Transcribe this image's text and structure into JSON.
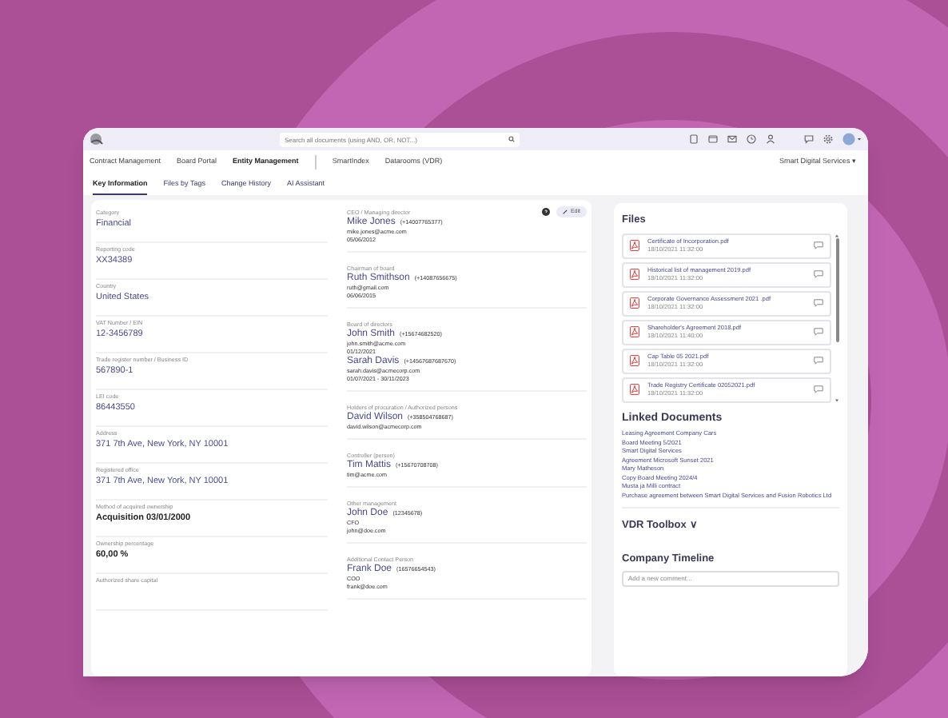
{
  "top_bar": {
    "search": {
      "placeholder": "Search all documents (using AND, OR, NOT...)"
    }
  },
  "nav": {
    "items": [
      {
        "label": "Contract Management",
        "selected": false
      },
      {
        "label": "Board Portal",
        "selected": false
      },
      {
        "label": "Entity Management",
        "selected": true
      },
      {
        "label": "SmartIndex",
        "selected": false
      },
      {
        "label": "Datarooms (VDR)",
        "selected": false
      }
    ],
    "company": "Smart Digital Services",
    "company_caret": "▾"
  },
  "tabs": [
    {
      "label": "Key Information",
      "selected": true
    },
    {
      "label": "Files by Tags",
      "selected": false
    },
    {
      "label": "Change History",
      "selected": false
    },
    {
      "label": "AI Assistant",
      "selected": false
    }
  ],
  "key_info": {
    "edit_button": "Edit",
    "fields": [
      {
        "label": "Category",
        "value": "Financial",
        "kind": "link"
      },
      {
        "label": "Reporting code",
        "value": "XX34389",
        "kind": "link"
      },
      {
        "label": "Country",
        "value": "United States",
        "kind": "link"
      },
      {
        "label": "VAT Number / EIN",
        "value": "12-3456789",
        "kind": "link"
      },
      {
        "label": "Trade register number / Business ID",
        "value": "567890-1",
        "kind": "link"
      },
      {
        "label": "LEI code",
        "value": "86443550",
        "kind": "link"
      },
      {
        "label": "Address",
        "value": "371 7th Ave, New York, NY 10001",
        "kind": "link"
      },
      {
        "label": "Registered office",
        "value": "371 7th Ave, New York, NY 10001",
        "kind": "link"
      },
      {
        "label": "Method of acquired ownership",
        "value": "Acquisition 03/01/2000",
        "kind": "plain"
      },
      {
        "label": "Ownership percentage",
        "value": "60,00 %",
        "kind": "plain"
      },
      {
        "label": "Authorized share capital"
      }
    ]
  },
  "contacts": [
    {
      "label": "CEO / Managing director",
      "persons": [
        {
          "name": "Mike Jones",
          "phone": "(+14007765377)",
          "lines": [
            "mike.jones@acme.com",
            "05/06/2012"
          ]
        }
      ]
    },
    {
      "label": "Chairman of board",
      "persons": [
        {
          "name": "Ruth Smithson",
          "phone": "(+14087656675)",
          "lines": [
            "ruth@gmail.com",
            "06/06/2015"
          ]
        }
      ]
    },
    {
      "label": "Board of directors",
      "persons": [
        {
          "name": "John Smith",
          "phone": "(+15674682520)",
          "lines": [
            "john.smith@acme.com",
            "01/12/2021"
          ]
        },
        {
          "name": "Sarah Davis",
          "phone": "(+14567687687670)",
          "lines": [
            "sarah.davis@acmecorp.com",
            "01/07/2021 - 30/11/2023"
          ]
        }
      ]
    },
    {
      "label": "Holders of procuration / Authorized persons",
      "persons": [
        {
          "name": "David Wilson",
          "phone": "(+358504768687)",
          "lines": [
            "david.wilson@acmecorp.com"
          ]
        }
      ]
    },
    {
      "label": "Controller (person)",
      "persons": [
        {
          "name": "Tim Mattis",
          "phone": "(+15670708708)",
          "lines": [
            "tim@acme.com"
          ]
        }
      ]
    },
    {
      "label": "Other management",
      "persons": [
        {
          "name": "John Doe",
          "phone": "(12345678)",
          "lines": [
            "CFO",
            "john@doe.com"
          ]
        }
      ]
    },
    {
      "label": "Additional Contact Person",
      "persons": [
        {
          "name": "Frank Doe",
          "phone": "(16576654543)",
          "lines": [
            "COO",
            "frank@doe.com"
          ]
        }
      ]
    }
  ],
  "files": {
    "title": "Files",
    "items": [
      {
        "name": "Certificate of Incorporation.pdf",
        "date": "18/10/2021 11:32:00"
      },
      {
        "name": "Historical list of management 2019.pdf",
        "date": "18/10/2021 11:32:00"
      },
      {
        "name": "Corporate Governance Assessment 2021 .pdf",
        "date": "18/10/2021 11:32:00"
      },
      {
        "name": "Shareholder's Agreement 2018.pdf",
        "date": "18/10/2021 11:40:00"
      },
      {
        "name": "Cap Table 05 2021.pdf",
        "date": "18/10/2021 11:32:00"
      },
      {
        "name": "Trade Registry Certificate 02052021.pdf",
        "date": "18/10/2021 11:32:00"
      }
    ]
  },
  "linked_documents": {
    "title": "Linked Documents",
    "items": [
      "Leasing Agreement Company Cars",
      "Board Meeting 5/2021",
      "Smart Digital Services",
      "Agreement Microsoft Sunset 2021",
      "Mary Matheson",
      "Copy Board Meeting 2024/4",
      "Musta ja Milli contract",
      "Purchase agreement between Smart Digital Services and Fusion Robotics Ltd"
    ]
  },
  "vdr_toolbox": {
    "title": "VDR Toolbox",
    "caret": "∨"
  },
  "company_timeline": {
    "title": "Company Timeline",
    "comment": {
      "placeholder": "Add a new comment..."
    }
  }
}
